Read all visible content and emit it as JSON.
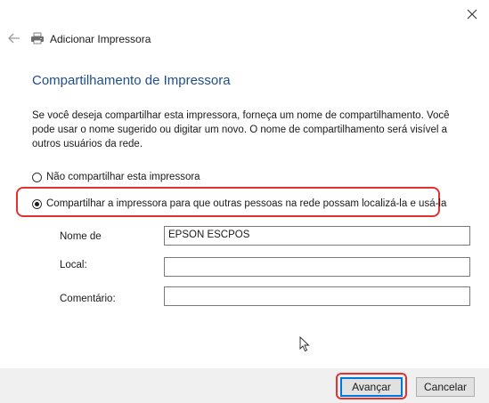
{
  "window": {
    "title": "Adicionar Impressora"
  },
  "page": {
    "heading": "Compartilhamento de Impressora",
    "description": "Se você deseja compartilhar esta impressora, forneça um nome de compartilhamento. Você pode usar o nome sugerido ou digitar um novo. O nome de compartilhamento será visível a outros usuários da rede."
  },
  "options": {
    "no_share": {
      "label": "Não compartilhar esta impressora",
      "selected": false
    },
    "share": {
      "label": "Compartilhar a impressora para que outras pessoas na rede possam localizá-la e usá-la",
      "selected": true
    }
  },
  "fields": {
    "share_name": {
      "label": "Nome de",
      "value": "EPSON ESCPOS"
    },
    "location": {
      "label": "Local:",
      "value": ""
    },
    "comment": {
      "label": "Comentário:",
      "value": ""
    }
  },
  "buttons": {
    "next": "Avançar",
    "cancel": "Cancelar"
  },
  "colors": {
    "heading": "#1f4e8c",
    "highlight": "#e23232",
    "default_button_border": "#0078d7"
  }
}
